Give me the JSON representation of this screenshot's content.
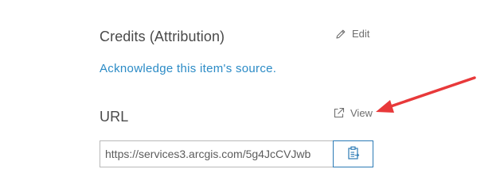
{
  "credits": {
    "title": "Credits (Attribution)",
    "edit_label": "Edit",
    "acknowledge_link": "Acknowledge this item's source."
  },
  "url_section": {
    "title": "URL",
    "view_label": "View",
    "url_value": "https://services3.arcgis.com/5g4JcCVJwb",
    "copy_icon": "clipboard-copy-icon"
  },
  "colors": {
    "link": "#2b8bc6",
    "button_border": "#2b7ab5",
    "annotation_arrow": "#e8393a"
  }
}
